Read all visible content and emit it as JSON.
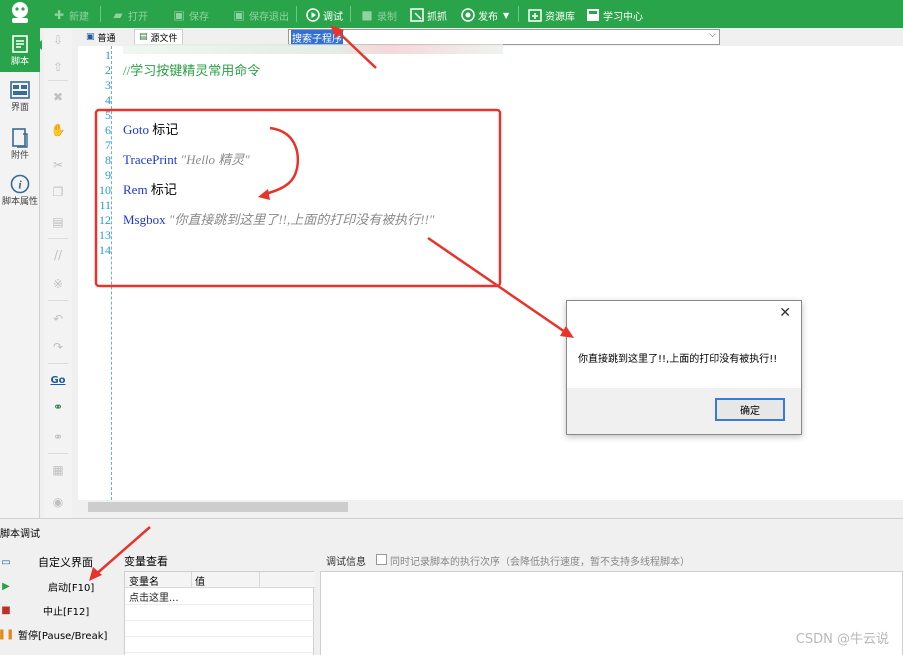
{
  "toolbar": {
    "buttons": [
      {
        "label": "新建",
        "icon": "plus-icon",
        "enabled": false
      },
      {
        "label": "打开",
        "icon": "folder-icon",
        "enabled": false
      },
      {
        "label": "保存",
        "icon": "save-icon",
        "enabled": false
      },
      {
        "label": "保存退出",
        "icon": "save-exit-icon",
        "enabled": false
      },
      {
        "label": "调试",
        "icon": "play-icon",
        "enabled": true
      },
      {
        "label": "录制",
        "icon": "camera-icon",
        "enabled": false
      },
      {
        "label": "抓抓",
        "icon": "grab-icon",
        "enabled": true
      },
      {
        "label": "发布",
        "icon": "publish-icon",
        "enabled": true
      },
      {
        "label": "资源库",
        "icon": "resource-icon",
        "enabled": true
      },
      {
        "label": "学习中心",
        "icon": "learn-icon",
        "enabled": true
      }
    ]
  },
  "leftnav": {
    "items": [
      {
        "label": "脚本",
        "icon": "script-icon"
      },
      {
        "label": "界面",
        "icon": "layout-icon"
      },
      {
        "label": "附件",
        "icon": "attachment-icon"
      },
      {
        "label": "脚本属性",
        "icon": "info-icon"
      }
    ]
  },
  "editor": {
    "tabs": [
      {
        "label": "普通",
        "icon": "normal-view-icon"
      },
      {
        "label": "源文件",
        "icon": "source-file-icon"
      }
    ],
    "search": {
      "value": "搜索子程序"
    },
    "line_numbers": [
      "1",
      "2",
      "3",
      "4",
      "5",
      "6",
      "7",
      "8",
      "9",
      "10",
      "11",
      "12",
      "13",
      "14"
    ],
    "lines": {
      "l1_comment": "//学习按键精灵常用命令",
      "l6_kw": "Goto",
      "l6_arg": " 标记",
      "l8_kw": "TracePrint",
      "l8_str": " \"Hello 精灵\"",
      "l10_kw": "Rem",
      "l10_arg": " 标记",
      "l12_kw": "Msgbox",
      "l12_str": " \"你直接跳到这里了!!,上面的打印没有被执行!!\""
    }
  },
  "debug_panel": {
    "title": "脚本调试",
    "buttons": [
      {
        "label": "自定义界面",
        "icon": "custom-ui-icon"
      },
      {
        "label": "启动[F10]",
        "icon": "play-icon"
      },
      {
        "label": "中止[F12]",
        "icon": "stop-icon"
      },
      {
        "label": "暂停[Pause/Break]",
        "icon": "pause-icon"
      }
    ],
    "var_title": "变量查看",
    "var_columns": [
      "变量名",
      "值"
    ],
    "var_cell": "点击这里...",
    "info_label": "调试信息",
    "checkbox_label": "同时记录脚本的执行次序（会降低执行速度，暂不支持多线程脚本）"
  },
  "dialog": {
    "message": "你直接跳到这里了!!,上面的打印没有被执行!!",
    "ok_label": "确定"
  },
  "watermark": "CSDN @牛云说",
  "colors": {
    "brand_green": "#2aa44a",
    "annotation_red": "#e8332a",
    "keyword_blue": "#1c38d6",
    "comment_green": "#2a9f45"
  }
}
